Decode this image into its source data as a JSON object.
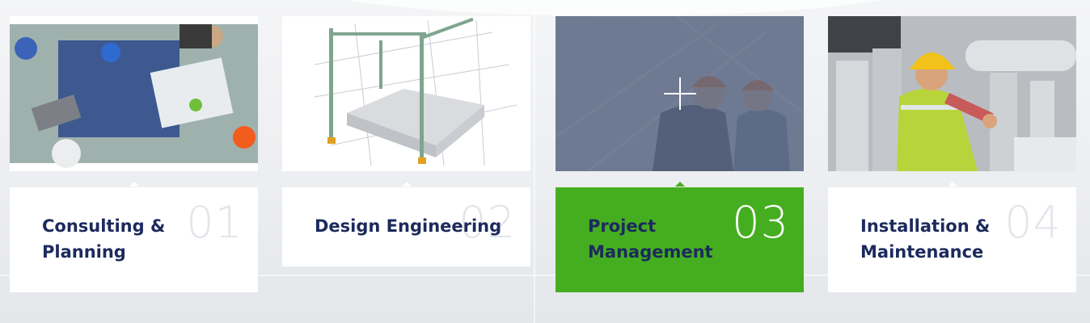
{
  "services": [
    {
      "number": "01",
      "title": "Consulting &\nPlanning",
      "image": "meeting-photo-icon",
      "active": false
    },
    {
      "number": "02",
      "title": "Design Engineering",
      "image": "construction-crane-photo-icon",
      "active": false
    },
    {
      "number": "03",
      "title": "Project\nManagement",
      "image": "engineers-hardhat-photo-icon",
      "active": true
    },
    {
      "number": "04",
      "title": "Installation &\nMaintenance",
      "image": "technician-ducts-photo-icon",
      "active": false
    }
  ],
  "colors": {
    "accent": "#45ae20",
    "title": "#1c2a5c",
    "number_inactive": "#e3e5ea",
    "overlay": "#5a6882"
  }
}
